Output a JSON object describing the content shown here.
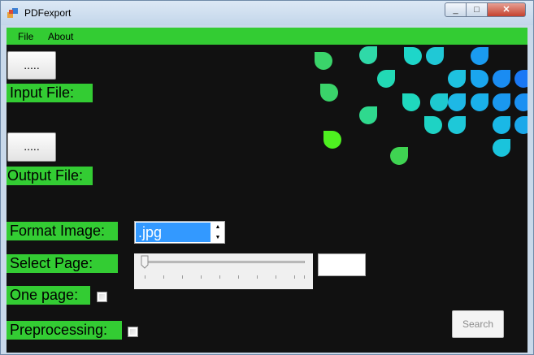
{
  "window": {
    "title": "PDFexport",
    "minimize_glyph": "_",
    "maximize_glyph": "□",
    "close_glyph": "✕"
  },
  "menu": {
    "items": [
      {
        "label": "File"
      },
      {
        "label": "About"
      }
    ]
  },
  "input": {
    "browse_label": ".....",
    "label": "Input File:"
  },
  "output": {
    "browse_label": ".....",
    "label": "Output File:"
  },
  "format": {
    "label": "Format Image:",
    "value": ".jpg",
    "up_glyph": "▲",
    "down_glyph": "▼"
  },
  "page_select": {
    "label": "Select Page:",
    "slider_value": 0,
    "page_value": ""
  },
  "one_page": {
    "label": "One page:",
    "checked": false
  },
  "preprocessing": {
    "label": "Preprocessing:",
    "checked": false
  },
  "search_button": {
    "label": "Search",
    "enabled": false
  },
  "colors": {
    "accent_green": "#33cc33",
    "background": "#111111",
    "selection_blue": "#3399ff"
  },
  "icons": [
    "app-icon",
    "minimize-icon",
    "maximize-icon",
    "close-icon",
    "slider-thumb-icon"
  ]
}
